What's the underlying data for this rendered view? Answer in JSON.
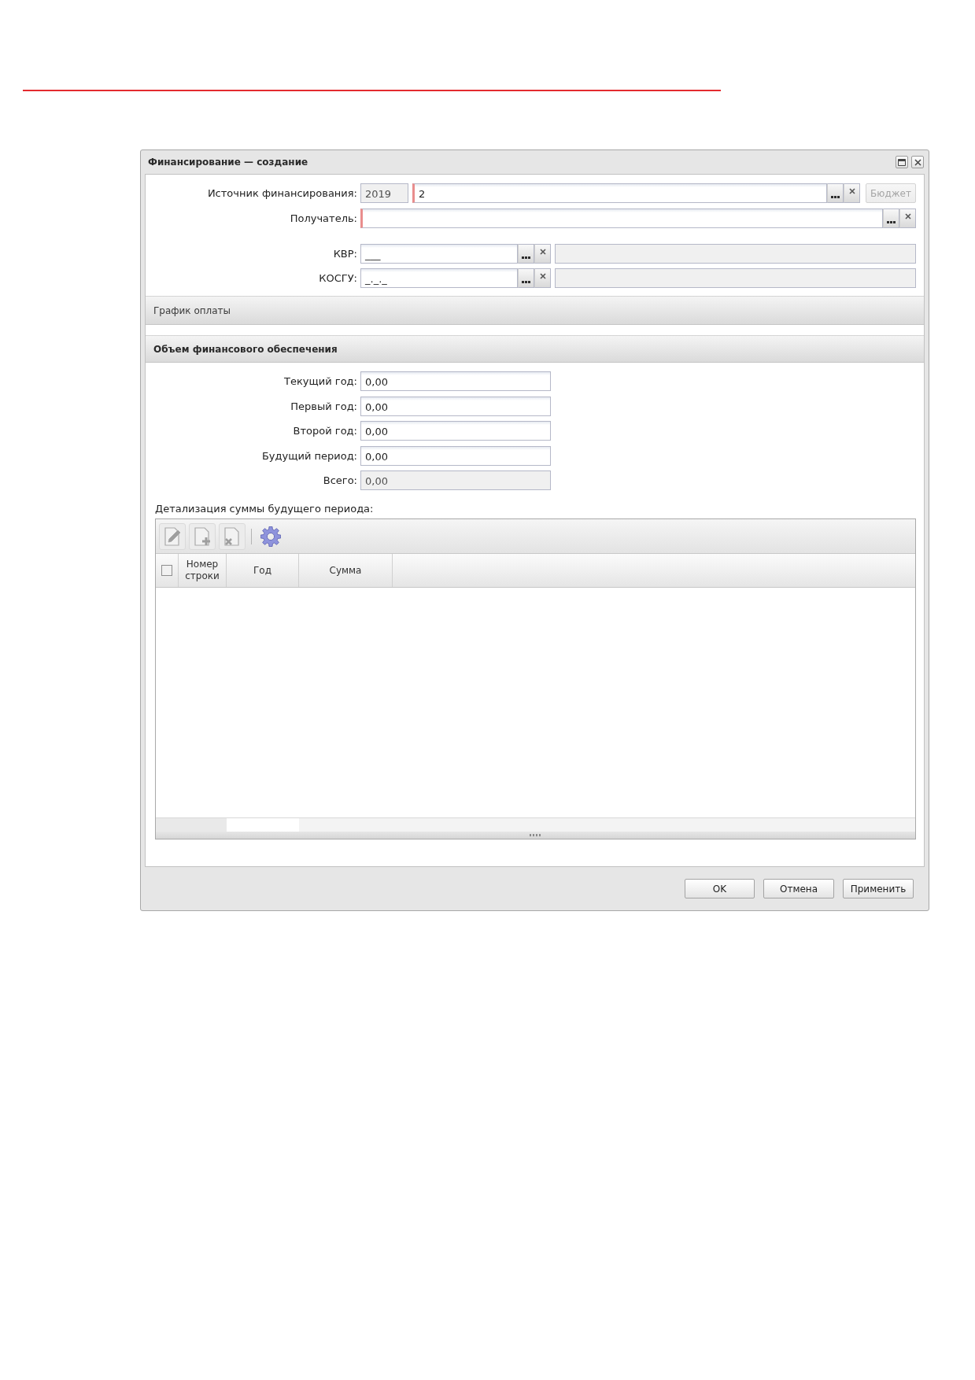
{
  "window": {
    "title": "Финансирование — создание"
  },
  "source": {
    "label": "Источник финансирования:",
    "year": {
      "value": "2019",
      "disabled": true
    },
    "code": {
      "value": "2",
      "required": true
    },
    "budget_button": {
      "label": "Бюджет",
      "disabled": true
    }
  },
  "recipient": {
    "label": "Получатель:",
    "required": true
  },
  "codes": [
    {
      "label": "КВР:",
      "value": "___",
      "required": false,
      "description": {
        "disabled": true
      }
    },
    {
      "label": "КОСГУ:",
      "value": "_._._",
      "required": false,
      "description": {
        "disabled": true
      }
    }
  ],
  "payment_schedule": {
    "title": "График оплаты",
    "expanded": false
  },
  "financing_volume": {
    "title": "Объем финансового обеспечения",
    "expanded": true,
    "amounts": [
      {
        "label": "Текущий год:",
        "value": "0,00",
        "disabled": false
      },
      {
        "label": "Первый год:",
        "value": "0,00",
        "disabled": false
      },
      {
        "label": "Второй год:",
        "value": "0,00",
        "disabled": false
      },
      {
        "label": "Будущий период:",
        "value": "0,00",
        "disabled": false
      },
      {
        "label": "Всего:",
        "value": "0,00",
        "disabled": true
      }
    ]
  },
  "future_detail": {
    "label": "Детализация суммы будущего периода:",
    "toolbar": [
      {
        "kind": "edit",
        "disabled": true
      },
      {
        "kind": "add",
        "disabled": true
      },
      {
        "kind": "delete",
        "disabled": true
      },
      {
        "kind": "separator"
      },
      {
        "kind": "settings",
        "disabled": false
      }
    ],
    "grid": {
      "select_all_checked": false,
      "columns": [
        {
          "label": "Номер строки"
        },
        {
          "label": "Год"
        },
        {
          "label": "Сумма"
        }
      ]
    }
  },
  "buttons": [
    {
      "label": "OK"
    },
    {
      "label": "Отмена"
    },
    {
      "label": "Применить"
    }
  ]
}
